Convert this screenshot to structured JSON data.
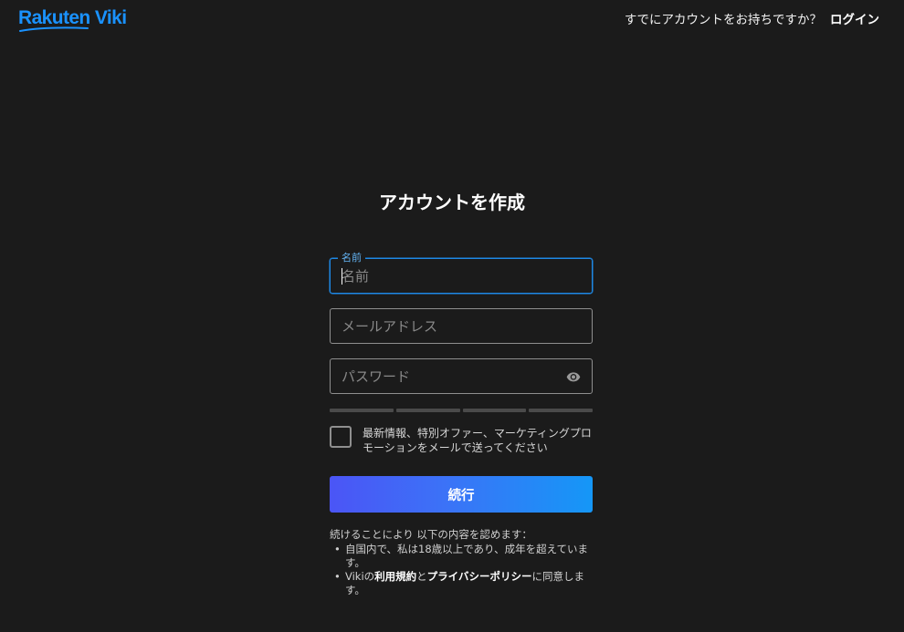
{
  "brand": {
    "logo_text": "Rakuten Viki",
    "color": "#1a92ff"
  },
  "header": {
    "prompt": "すでにアカウントをお持ちですか？",
    "login_link": "ログイン"
  },
  "form": {
    "title": "アカウントを作成",
    "name": {
      "label": "名前",
      "placeholder": "名前",
      "value": ""
    },
    "email": {
      "placeholder": "メールアドレス",
      "value": ""
    },
    "password": {
      "placeholder": "パスワード",
      "value": "",
      "icon": "eye-icon"
    },
    "strength_segments": 4,
    "optin": {
      "checked": false,
      "text": "最新情報、特別オファー、マーケティングプロモーションをメールで送ってください"
    },
    "continue_button": "続行",
    "accent_gradient": [
      "#4b55f6",
      "#1597f7"
    ]
  },
  "terms": {
    "intro": "続けることにより 以下の内容を認めます：",
    "item1": "自国内で、私は18歳以上であり、成年を超えています。",
    "item2_prefix": "Vikiの",
    "item2_link1": "利用規約",
    "item2_mid": "と",
    "item2_link2": "プライバシーポリシー",
    "item2_suffix": "に同意します。"
  }
}
